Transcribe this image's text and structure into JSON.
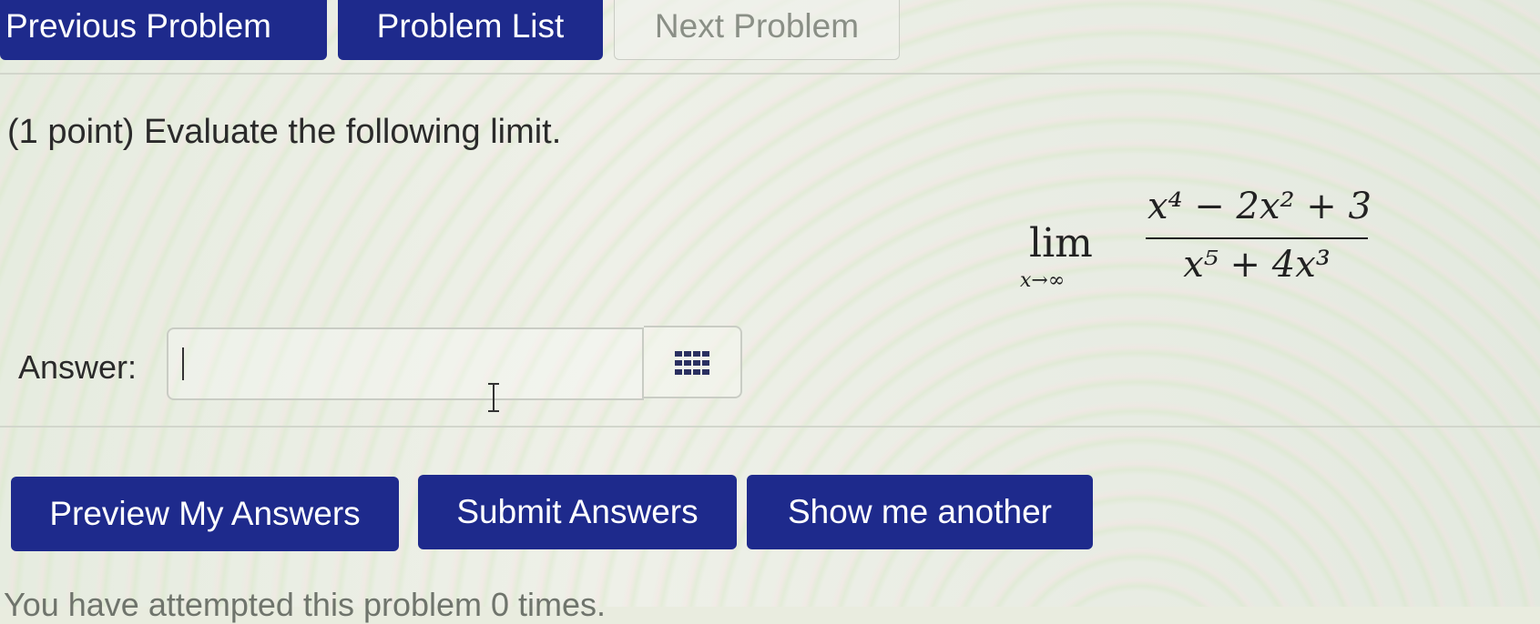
{
  "nav": {
    "previous_label": "Previous Problem",
    "list_label": "Problem List",
    "next_label": "Next Problem"
  },
  "problem": {
    "prompt": "(1 point) Evaluate the following limit.",
    "math": {
      "lim_word": "lim",
      "lim_sub": "x→∞",
      "numerator": "x⁴ − 2x² + 3",
      "denominator": "x⁵ + 4x³"
    }
  },
  "answer": {
    "label": "Answer:",
    "value": "",
    "palette_icon": "grid-icon"
  },
  "actions": {
    "preview_label": "Preview My Answers",
    "submit_label": "Submit Answers",
    "another_label": "Show me another"
  },
  "status": {
    "attempts_text": "You have attempted this problem 0 times."
  },
  "colors": {
    "button_bg": "#1e2a8c",
    "button_text": "#ffffff",
    "disabled_text": "#8a8f86"
  }
}
